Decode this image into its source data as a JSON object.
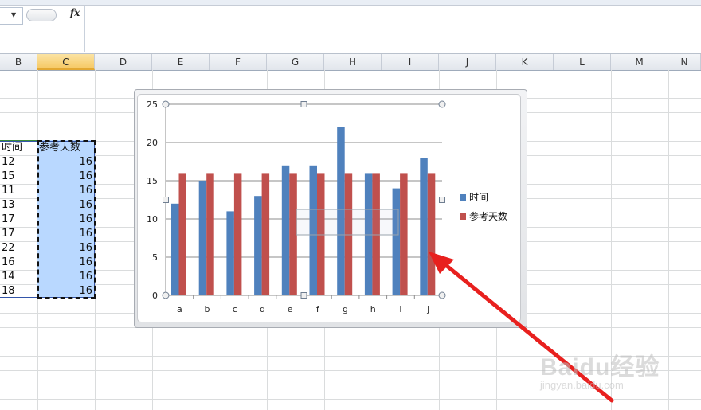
{
  "formula_bar": {
    "fx_label": "fx",
    "formula_value": ""
  },
  "columns": [
    "B",
    "C",
    "D",
    "E",
    "F",
    "G",
    "H",
    "I",
    "J",
    "K",
    "L",
    "M",
    "N"
  ],
  "selected_column": "C",
  "table": {
    "header_b": "时间",
    "header_c": "参考天数",
    "col_b": [
      "12",
      "15",
      "11",
      "13",
      "17",
      "17",
      "22",
      "16",
      "14",
      "18"
    ],
    "col_c": [
      "16",
      "16",
      "16",
      "16",
      "16",
      "16",
      "16",
      "16",
      "16",
      "16"
    ]
  },
  "chart_data": {
    "type": "bar",
    "categories": [
      "a",
      "b",
      "c",
      "d",
      "e",
      "f",
      "g",
      "h",
      "i",
      "j"
    ],
    "series": [
      {
        "name": "时间",
        "values": [
          12,
          15,
          11,
          13,
          17,
          17,
          22,
          16,
          14,
          18
        ],
        "color": "#4f81bd"
      },
      {
        "name": "参考天数",
        "values": [
          16,
          16,
          16,
          16,
          16,
          16,
          16,
          16,
          16,
          16
        ],
        "color": "#c0504d"
      }
    ],
    "yticks": [
      "0",
      "5",
      "10",
      "15",
      "20",
      "25"
    ],
    "ylim": [
      0,
      25
    ],
    "grid": true,
    "legend_position": "right"
  },
  "annotation": {
    "arrow_color": "#e8201e"
  },
  "watermark": {
    "main": "Baidu经验",
    "sub": "jingyan.baidu.com"
  }
}
